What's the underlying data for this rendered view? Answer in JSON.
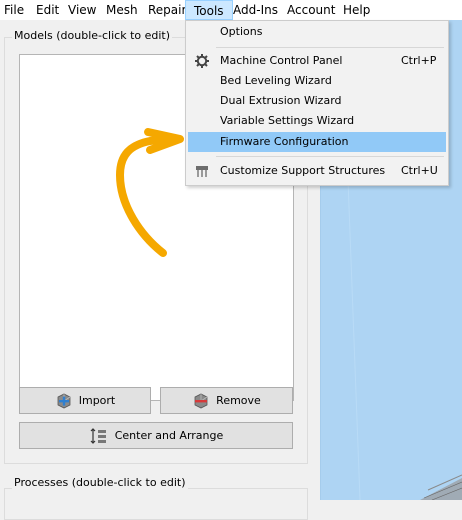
{
  "menubar": {
    "items": [
      {
        "label": "File"
      },
      {
        "label": "Edit"
      },
      {
        "label": "View"
      },
      {
        "label": "Mesh"
      },
      {
        "label": "Repair"
      },
      {
        "label": "Tools"
      },
      {
        "label": "Add-Ins"
      },
      {
        "label": "Account"
      },
      {
        "label": "Help"
      }
    ],
    "active": "Tools"
  },
  "tools_menu": {
    "items": [
      {
        "label": "Options",
        "shortcut": ""
      },
      {
        "label": "Machine Control Panel",
        "shortcut": "Ctrl+P",
        "icon": "gear-icon"
      },
      {
        "label": "Bed Leveling Wizard",
        "shortcut": ""
      },
      {
        "label": "Dual Extrusion Wizard",
        "shortcut": ""
      },
      {
        "label": "Variable Settings Wizard",
        "shortcut": ""
      },
      {
        "label": "Firmware Configuration",
        "shortcut": "",
        "highlighted": true
      },
      {
        "label": "Customize Support Structures",
        "shortcut": "Ctrl+U",
        "icon": "support-structures-icon"
      }
    ]
  },
  "models_panel": {
    "title": "Models (double-click to edit)",
    "import_label": "Import",
    "remove_label": "Remove",
    "center_arrange_label": "Center and Arrange"
  },
  "processes_panel": {
    "title": "Processes (double-click to edit)"
  },
  "colors": {
    "highlight": "#91c9f7",
    "viewport": "#aed4f3",
    "annotation_arrow": "#f5a800"
  }
}
